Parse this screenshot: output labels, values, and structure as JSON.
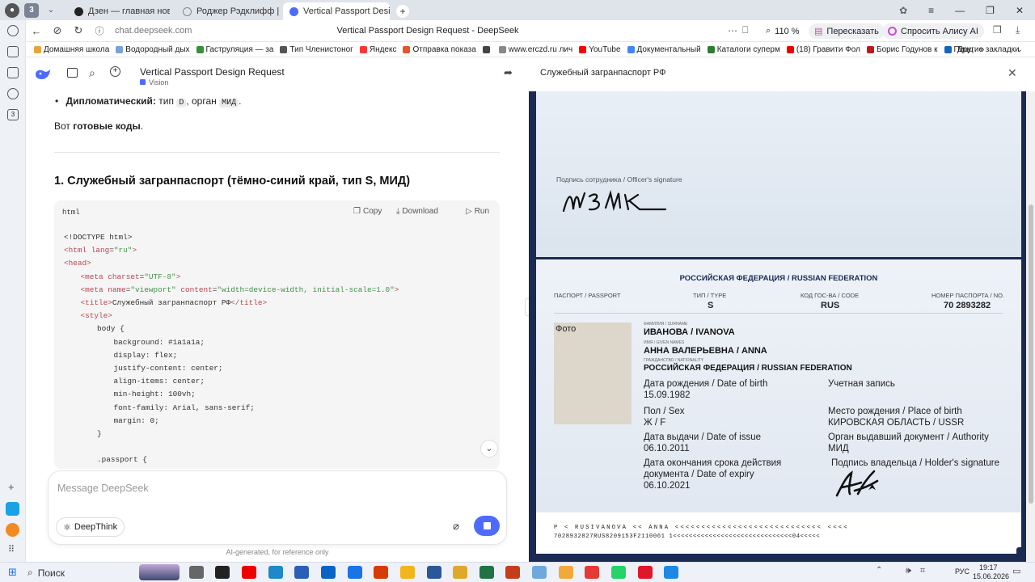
{
  "browser": {
    "tab_count": "3",
    "tabs": [
      {
        "label": "Дзен — главная новостн"
      },
      {
        "label": "Роджер Рэдклифф | Disn"
      },
      {
        "label": "Vertical Passport Desig"
      }
    ],
    "url": "chat.deepseek.com",
    "page_title": "Vertical Passport Design Request - DeepSeek",
    "zoom": "110 %",
    "retell_label": "Пересказать",
    "alice_label": "Спросить Алису AI",
    "bookmarks": [
      {
        "label": "Домашняя школа",
        "color": "#e8a33c"
      },
      {
        "label": "Водородный дых",
        "color": "#7aa1d8"
      },
      {
        "label": "Гаструляция — за",
        "color": "#3a8f3a"
      },
      {
        "label": "Тип Членистоног",
        "color": "#555555"
      },
      {
        "label": "Яндекс",
        "color": "#f33"
      },
      {
        "label": "Отправка показа",
        "color": "#e2572b"
      },
      {
        "label": "",
        "color": "#444444"
      },
      {
        "label": "www.erczd.ru лич",
        "color": "#888888"
      },
      {
        "label": "YouTube",
        "color": "#f00"
      },
      {
        "label": "Документальный",
        "color": "#4285f4"
      },
      {
        "label": "Каталоги суперм",
        "color": "#2e7d32"
      },
      {
        "label": "(18) Гравити Фол",
        "color": "#e00"
      },
      {
        "label": "Борис Годунов к",
        "color": "#b71c1c"
      },
      {
        "label": "Пицц",
        "color": "#1565c0"
      }
    ],
    "other_bookmarks": "Другие закладки"
  },
  "chat": {
    "title": "Vertical Passport Design Request",
    "subtitle": "Vision",
    "bullet_bold": "Дипломатический:",
    "bullet_text_1": "тип",
    "bullet_code_1": "D",
    "bullet_text_2": ", орган",
    "bullet_code_2": "МИД",
    "bullet_text_3": ".",
    "ready_prefix": "Вот",
    "ready_bold": "готовые коды",
    "ready_suffix": ".",
    "section_heading": "1. Служебный загранпаспорт (тёмно-синий край, тип S, МИД)",
    "code_lang": "html",
    "copy_label": "Copy",
    "download_label": "Download",
    "run_label": "Run",
    "code_lines": [
      {
        "indent": 0,
        "parts": [
          {
            "t": "<!DOCTYPE html>",
            "c": "plain"
          }
        ]
      },
      {
        "indent": 0,
        "parts": [
          {
            "t": "<html",
            "c": "tag"
          },
          {
            "t": " lang",
            "c": "attr"
          },
          {
            "t": "=",
            "c": "plain"
          },
          {
            "t": "\"ru\"",
            "c": "str"
          },
          {
            "t": ">",
            "c": "tag"
          }
        ]
      },
      {
        "indent": 0,
        "parts": [
          {
            "t": "<head>",
            "c": "tag"
          }
        ]
      },
      {
        "indent": 1,
        "parts": [
          {
            "t": "<meta",
            "c": "tag"
          },
          {
            "t": " charset",
            "c": "attr"
          },
          {
            "t": "=",
            "c": "plain"
          },
          {
            "t": "\"UTF-8\"",
            "c": "str"
          },
          {
            "t": ">",
            "c": "tag"
          }
        ]
      },
      {
        "indent": 1,
        "parts": [
          {
            "t": "<meta",
            "c": "tag"
          },
          {
            "t": " name",
            "c": "attr"
          },
          {
            "t": "=",
            "c": "plain"
          },
          {
            "t": "\"viewport\"",
            "c": "str"
          },
          {
            "t": " content",
            "c": "attr"
          },
          {
            "t": "=",
            "c": "plain"
          },
          {
            "t": "\"width=device-width, initial-scale=1.0\"",
            "c": "str"
          },
          {
            "t": ">",
            "c": "tag"
          }
        ]
      },
      {
        "indent": 1,
        "parts": [
          {
            "t": "<title>",
            "c": "tag"
          },
          {
            "t": "Служебный загранпаспорт РФ",
            "c": "plain"
          },
          {
            "t": "</title>",
            "c": "tag"
          }
        ]
      },
      {
        "indent": 1,
        "parts": [
          {
            "t": "<style>",
            "c": "tag"
          }
        ]
      },
      {
        "indent": 2,
        "parts": [
          {
            "t": "body {",
            "c": "plain"
          }
        ]
      },
      {
        "indent": 3,
        "parts": [
          {
            "t": "background: #1a1a1a;",
            "c": "plain"
          }
        ]
      },
      {
        "indent": 3,
        "parts": [
          {
            "t": "display: flex;",
            "c": "plain"
          }
        ]
      },
      {
        "indent": 3,
        "parts": [
          {
            "t": "justify-content: center;",
            "c": "plain"
          }
        ]
      },
      {
        "indent": 3,
        "parts": [
          {
            "t": "align-items: center;",
            "c": "plain"
          }
        ]
      },
      {
        "indent": 3,
        "parts": [
          {
            "t": "min-height: 100vh;",
            "c": "plain"
          }
        ]
      },
      {
        "indent": 3,
        "parts": [
          {
            "t": "font-family: Arial, sans-serif;",
            "c": "plain"
          }
        ]
      },
      {
        "indent": 3,
        "parts": [
          {
            "t": "margin: 0;",
            "c": "plain"
          }
        ]
      },
      {
        "indent": 2,
        "parts": [
          {
            "t": "}",
            "c": "plain"
          }
        ]
      },
      {
        "indent": 0,
        "parts": [
          {
            "t": "",
            "c": "plain"
          }
        ]
      },
      {
        "indent": 2,
        "parts": [
          {
            "t": ".passport {",
            "c": "plain"
          }
        ]
      }
    ],
    "input_placeholder": "Message DeepSeek",
    "deepthink_label": "DeepThink",
    "footer_note": "AI-generated, for reference only"
  },
  "preview": {
    "title": "Служебный загранпаспорт РФ",
    "officer_sig_label": "Подпись сотрудника / Officer's signature",
    "country": "РОССИЙСКАЯ ФЕДЕРАЦИЯ / RUSSIAN FEDERATION",
    "passport_label": "ПАСПОРТ / PASSPORT",
    "type_label": "ТИП / TYPE",
    "type_value": "S",
    "code_label": "КОД ГОС-ВА / CODE",
    "code_value": "RUS",
    "number_label": "НОМЕР ПАСПОРТА / NO.",
    "number_value": "70 2893282",
    "photo_alt": "Фото",
    "surname_label": "ФАМИЛИЯ / SURNAME",
    "surname": "ИВАНОВА / IVANOVA",
    "given_label": "ИМЯ / GIVEN NAMES",
    "given": "АННА ВАЛЕРЬЕВНА / ANNA",
    "nationality_label": "ГРАЖДАНСТВО / NATIONALITY",
    "nationality": "РОССИЙСКАЯ ФЕДЕРАЦИЯ / RUSSIAN FEDERATION",
    "dob_label": "Дата рождения / Date of birth",
    "dob": "15.09.1982",
    "record_label": "Учетная запись",
    "pob_label": "Место рождения / Place of birth",
    "pob": "КИРОВСКАЯ ОБЛАСТЬ / USSR",
    "sex_label": "Пол / Sex",
    "sex": "Ж / F",
    "issue_label": "Дата выдачи / Date of issue",
    "issue": "06.10.2011",
    "authority_label": "Орган выдавший документ / Authority",
    "authority": "МИД",
    "expiry_label_1": "Дата окончания срока действия",
    "expiry_label_2": "документа / Date of expiry",
    "expiry": "06.10.2021",
    "holder_sig_label": "Подпись владельца / Holder's signature",
    "mrz_1": "P < RUSIVANOVA << ANNA <<<<<<<<<<<<<<<<<<<<<<<<<<<< <<<<",
    "mrz_2": "7028932827RUS8209153F2110061 1<<<<<<<<<<<<<<<<<<<<<<<<<<<<<<04<<<<<"
  },
  "taskbar": {
    "search_label": "Поиск",
    "lang": "РУС",
    "time": "19:17",
    "date": "15.06.2026"
  },
  "colors": {
    "deepseek_blue": "#4d6bfe",
    "passport_navy": "#1b2a52"
  }
}
